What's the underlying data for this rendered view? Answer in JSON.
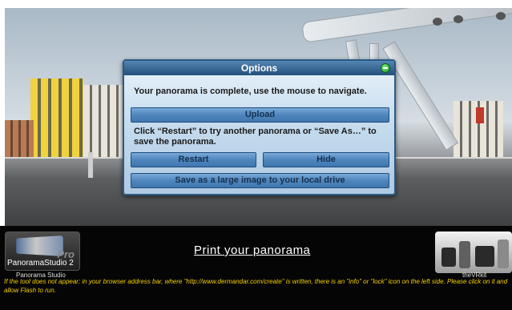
{
  "dialog": {
    "title": "Options",
    "complete_msg": "Your panorama is complete, use the mouse to navigate.",
    "upload_label": "Upload",
    "hint": "Click “Restart” to try another panorama or “Save As…” to save the panorama.",
    "restart_label": "Restart",
    "hide_label": "Hide",
    "save_label": "Save as a large image to your local drive"
  },
  "footer": {
    "left_logo_name": "PanoramaStudio 2",
    "left_logo_pro": "Pro",
    "left_caption": "Panorama Studio",
    "print_link": "Print your panorama",
    "right_caption": "theVRkit",
    "notice": "If the tool does not appear: in your browser address bar, where \"http://www.dermandar.com/create\" is written, there is an \"info\" or \"lock\" icon on the left side. Please click on it and allow Flash to run."
  },
  "colors": {
    "dialog_title_bg": "#234f7c",
    "button_bg": "#4f86bd",
    "notice_text": "#f4d000",
    "footer_bg": "#050505"
  }
}
